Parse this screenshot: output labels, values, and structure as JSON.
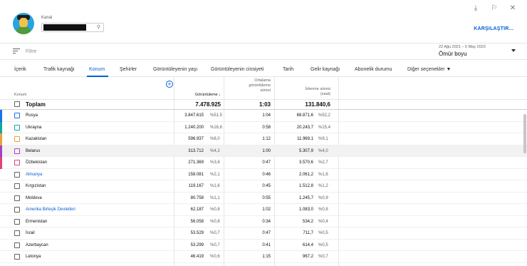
{
  "window": {
    "download_icon": "download-icon",
    "feedback_icon": "feedback-icon",
    "close_icon": "close-icon"
  },
  "channel": {
    "label": "Kanal",
    "search_icon": "search-icon"
  },
  "compare_label": "KARŞILAŞTIR...",
  "filter": {
    "placeholder": "Filtre",
    "date_range_sub": "22 Ağu 2021 – 5 May 2023",
    "date_range_main": "Ömür boyu"
  },
  "tabs": [
    {
      "label": "İçerik"
    },
    {
      "label": "Trafik kaynağı"
    },
    {
      "label": "Konum"
    },
    {
      "label": "Şehirler"
    },
    {
      "label": "Görüntüleyenin yaşı"
    },
    {
      "label": "Görüntüleyenin cinsiyeti"
    },
    {
      "label": "Tarih"
    },
    {
      "label": "Gelir kaynağı"
    },
    {
      "label": "Abonelik durumu"
    },
    {
      "label": "Diğer seçenekler ▼"
    }
  ],
  "columns": {
    "location": "Konum",
    "views": "Görüntüleme ↓",
    "avg_duration_1": "Ortalama",
    "avg_duration_2": "görüntüleme",
    "avg_duration_3": "süresi",
    "watch_time_1": "İzlenme süresi",
    "watch_time_2": "(saat)"
  },
  "total": {
    "name": "Toplam",
    "views": "7.478.925",
    "avg_duration": "1:03",
    "watch_time": "131.840,6"
  },
  "rows": [
    {
      "name": "Rusya",
      "views": "3.847.615",
      "views_pct": "%51,5",
      "avg": "1:04",
      "watch": "68.871,6",
      "watch_pct": "%52,2",
      "color": "#1a73e8",
      "link": false
    },
    {
      "name": "Ukrayna",
      "views": "1.240.200",
      "views_pct": "%16,6",
      "avg": "0:58",
      "watch": "20.243,7",
      "watch_pct": "%15,4",
      "color": "#12a7a1",
      "link": false
    },
    {
      "name": "Kazakistan",
      "views": "596.937",
      "views_pct": "%8,0",
      "avg": "1:12",
      "watch": "11.969,1",
      "watch_pct": "%9,1",
      "color": "#e8a33d",
      "link": false
    },
    {
      "name": "Belarus",
      "views": "313.712",
      "views_pct": "%4,2",
      "avg": "1:00",
      "watch": "5.307,9",
      "watch_pct": "%4,0",
      "color": "#a142c9",
      "link": false
    },
    {
      "name": "Özbekistan",
      "views": "271.369",
      "views_pct": "%3,6",
      "avg": "0:47",
      "watch": "3.570,6",
      "watch_pct": "%2,7",
      "color": "#e0427a",
      "link": false
    },
    {
      "name": "Almanya",
      "views": "158.081",
      "views_pct": "%2,1",
      "avg": "0:46",
      "watch": "2.061,2",
      "watch_pct": "%1,6",
      "color": "",
      "link": true
    },
    {
      "name": "Kırgızistan",
      "views": "119.167",
      "views_pct": "%1,6",
      "avg": "0:45",
      "watch": "1.512,8",
      "watch_pct": "%1,2",
      "color": "",
      "link": false
    },
    {
      "name": "Moldova",
      "views": "80.758",
      "views_pct": "%1,1",
      "avg": "0:55",
      "watch": "1.245,7",
      "watch_pct": "%0,9",
      "color": "",
      "link": false
    },
    {
      "name": "Amerika Birleşik Devletleri",
      "views": "62.187",
      "views_pct": "%0,8",
      "avg": "1:02",
      "watch": "1.083,0",
      "watch_pct": "%0,8",
      "color": "",
      "link": true
    },
    {
      "name": "Ermenistan",
      "views": "56.058",
      "views_pct": "%0,8",
      "avg": "0:34",
      "watch": "534,2",
      "watch_pct": "%0,4",
      "color": "",
      "link": false
    },
    {
      "name": "İsrail",
      "views": "53.529",
      "views_pct": "%0,7",
      "avg": "0:47",
      "watch": "711,7",
      "watch_pct": "%0,5",
      "color": "",
      "link": false
    },
    {
      "name": "Azerbaycan",
      "views": "53.299",
      "views_pct": "%0,7",
      "avg": "0:41",
      "watch": "614,4",
      "watch_pct": "%0,5",
      "color": "",
      "link": false
    },
    {
      "name": "Letonya",
      "views": "46.419",
      "views_pct": "%0,6",
      "avg": "1:15",
      "watch": "967,2",
      "watch_pct": "%0,7",
      "color": "",
      "link": false
    }
  ]
}
